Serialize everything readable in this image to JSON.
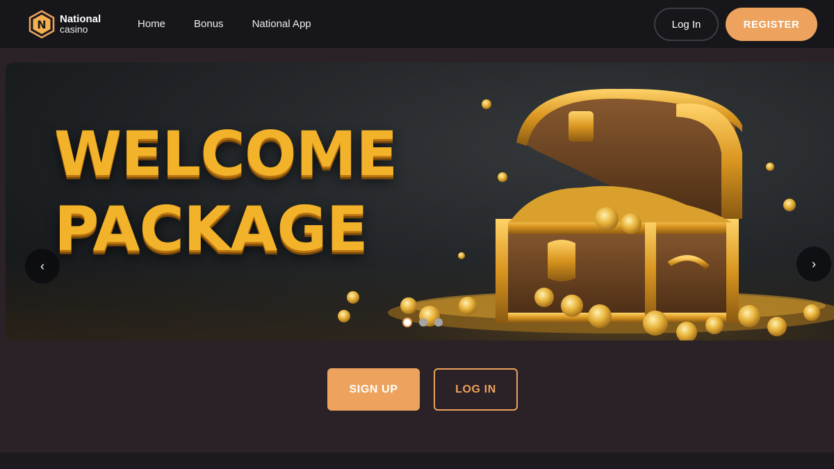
{
  "brand": {
    "logo_letter": "N",
    "name_line1": "National",
    "name_line2": "casino",
    "accent_color": "#eda35d"
  },
  "nav": {
    "items": [
      {
        "label": "Home"
      },
      {
        "label": "Bonus"
      },
      {
        "label": "National App"
      }
    ]
  },
  "header_actions": {
    "login_label": "Log In",
    "register_label": "REGISTER"
  },
  "banner": {
    "headline_line1": "WELCOME",
    "headline_line2": "PACKAGE",
    "prev_icon": "‹",
    "next_icon": "›",
    "slides": 3,
    "active_slide": 1
  },
  "cta": {
    "signup_label": "SIGN UP",
    "login_label": "LOG IN"
  },
  "colors": {
    "header_bg": "#17161a",
    "page_bg": "#2a2226",
    "gold_text": "#f2b22a"
  }
}
